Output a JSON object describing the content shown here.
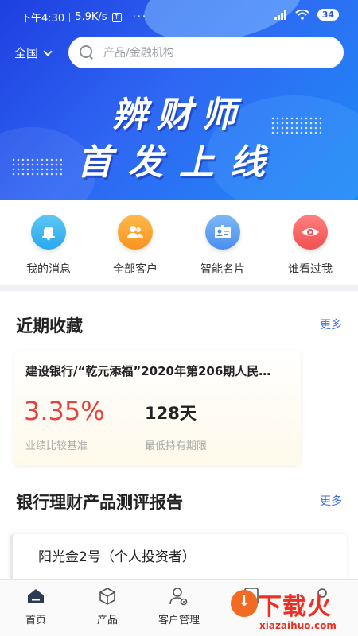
{
  "status_bar": {
    "time": "下午4:30",
    "speed": "5.9K/s",
    "dots": "···",
    "battery": "34"
  },
  "header": {
    "region": "全国",
    "search_placeholder": "产品/金融机构"
  },
  "banner": {
    "line1": "辨财师",
    "line2": "首发上线"
  },
  "quick_entries": [
    {
      "label": "我的消息",
      "icon": "bell-icon"
    },
    {
      "label": "全部客户",
      "icon": "users-icon"
    },
    {
      "label": "智能名片",
      "icon": "id-card-icon"
    },
    {
      "label": "谁看过我",
      "icon": "eye-icon"
    }
  ],
  "favorites": {
    "title": "近期收藏",
    "more": "更多",
    "card": {
      "name": "建设银行/“乾元添福”2020年第206期人民…",
      "rate": "3.35%",
      "rate_label": "业绩比较基准",
      "days": "128天",
      "days_label": "最低持有期限"
    }
  },
  "reports": {
    "title": "银行理财产品测评报告",
    "more": "更多",
    "first_item": "阳光金2号（个人投资者）"
  },
  "bottom_nav": [
    {
      "label": "首页",
      "icon": "home-icon",
      "active": true
    },
    {
      "label": "产品",
      "icon": "box-icon"
    },
    {
      "label": "客户管理",
      "icon": "user-gear-icon"
    },
    {
      "label": "",
      "icon": "doc-icon"
    },
    {
      "label": "",
      "icon": "person-icon"
    }
  ],
  "watermark": {
    "main": "下载火",
    "sub": "xiazaihuo.com"
  },
  "colors": {
    "banner_primary": "#2f66f3",
    "accent_link": "#3d6be0",
    "rate_red": "#e9413d"
  }
}
